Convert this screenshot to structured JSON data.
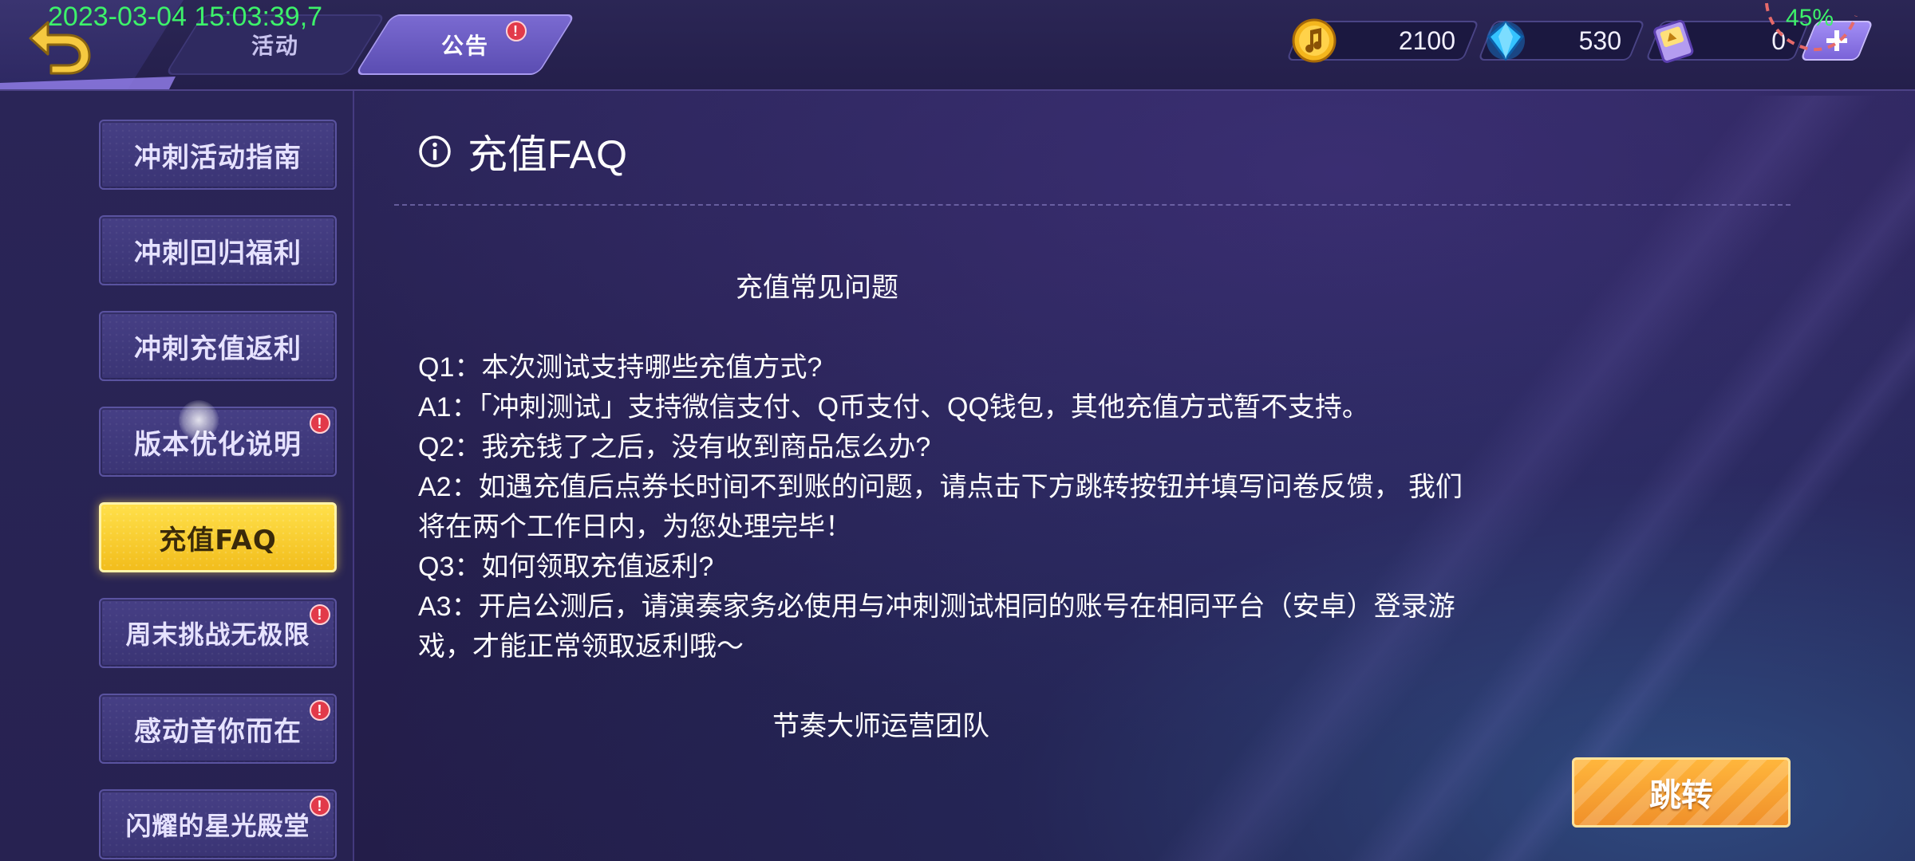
{
  "status": {
    "timestamp": "2023-03-04 15:03:39,7",
    "battery": "45%"
  },
  "top_tabs": [
    {
      "label": "活动"
    },
    {
      "label": "公告",
      "badge": "!"
    }
  ],
  "currencies": [
    {
      "icon": "gold-note-coin-icon",
      "amount": "2100"
    },
    {
      "icon": "blue-diamond-icon",
      "amount": "530"
    },
    {
      "icon": "ticket-card-icon",
      "amount": "0"
    }
  ],
  "add_button_icon": "plus-icon",
  "sidebar": {
    "items": [
      {
        "label": "冲刺活动指南",
        "badge": ""
      },
      {
        "label": "冲刺回归福利",
        "badge": ""
      },
      {
        "label": "冲刺充值返利",
        "badge": ""
      },
      {
        "label": "版本优化说明",
        "badge": "!"
      },
      {
        "label": "充值FAQ",
        "badge": "",
        "active": true
      },
      {
        "label": "周末挑战无极限",
        "badge": "!"
      },
      {
        "label": "感动音你而在",
        "badge": "!"
      },
      {
        "label": "闪耀的星光殿堂",
        "badge": "!"
      }
    ]
  },
  "main": {
    "title": "充值FAQ",
    "heading": "充值常见问题",
    "lines": [
      "Q1：本次测试支持哪些充值方式?",
      "A1：「冲刺测试」支持微信支付、Q币支付、QQ钱包，其他充值方式暂不支持。",
      "Q2：我充钱了之后，没有收到商品怎么办?",
      "A2：如遇充值后点券长时间不到账的问题，请点击下方跳转按钮并填写问卷反馈， 我们",
      "将在两个工作日内，为您处理完毕！",
      "Q3：如何领取充值返利?",
      "A3：开启公测后，请演奏家务必使用与冲刺测试相同的账号在相同平台（安卓）登录游",
      "戏，才能正常领取返利哦～"
    ],
    "signature": "节奏大师运营团队",
    "jump_button": "跳转"
  },
  "colors": {
    "active_tab": "#ffd43a",
    "badge": "#e23a4a",
    "overlay_text": "#3df26a",
    "jump_button": "#f5a231"
  }
}
